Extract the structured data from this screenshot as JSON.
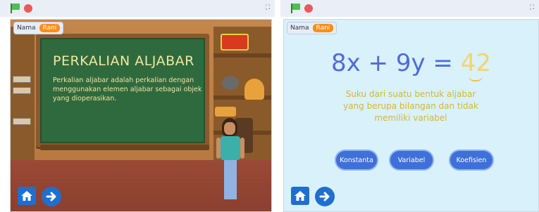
{
  "left_stage": {
    "name_label": "Nama",
    "name_value": "Rani",
    "board_title": "PERKALIAN ALJABAR",
    "board_text": "Perkalian aljabar adalah perkalian dengan menggunakan elemen aljabar sebagai objek yang dioperasikan."
  },
  "right_stage": {
    "name_label": "Nama",
    "name_value": "Rani",
    "equation_left": "8x + 9y = ",
    "equation_highlight": "42",
    "description": "Suku dari suatu bentuk aljabar yang berupa bilangan dan tidak memiliki variabel",
    "options": [
      "Konstanta",
      "Variabel",
      "Koefisien"
    ]
  },
  "icons": {
    "flag": "green-flag-icon",
    "stop": "stop-icon",
    "fullscreen": "fullscreen-icon",
    "home": "home-icon",
    "next": "arrow-right-icon"
  },
  "colors": {
    "flag_green": "#4cbf56",
    "stop_red": "#ec5959",
    "name_badge": "#ff8c1a",
    "button_blue": "#1f6fd0",
    "equation_blue": "#4f6bdc",
    "accent_yellow": "#f6d469"
  }
}
